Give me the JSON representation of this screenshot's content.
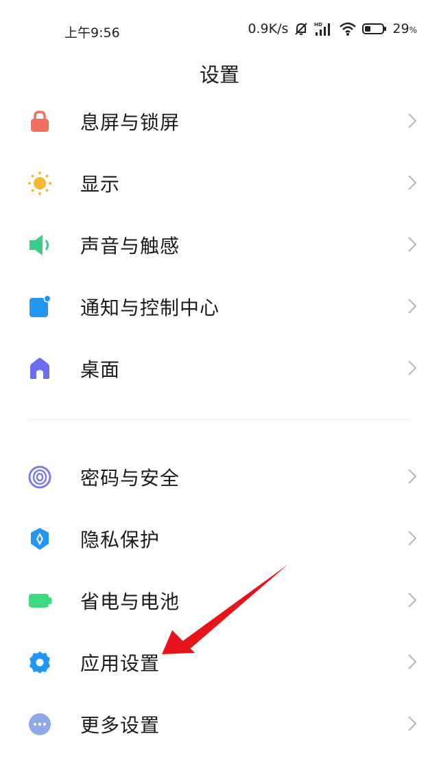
{
  "status": {
    "time": "上午9:56",
    "net_speed": "0.9K/s",
    "battery": "29",
    "battery_unit": "%"
  },
  "page": {
    "title": "设置"
  },
  "group1": [
    {
      "label": "息屏与锁屏",
      "icon": "lock-icon",
      "color": "#F2705F"
    },
    {
      "label": "显示",
      "icon": "sun-icon",
      "color": "#F7B731"
    },
    {
      "label": "声音与触感",
      "icon": "speaker-icon",
      "color": "#3DCB87"
    },
    {
      "label": "通知与控制中心",
      "icon": "notification-icon",
      "color": "#2196F3"
    },
    {
      "label": "桌面",
      "icon": "home-icon",
      "color": "#6C6CF0"
    }
  ],
  "group2": [
    {
      "label": "密码与安全",
      "icon": "fingerprint-icon",
      "color": "#7B7BE8"
    },
    {
      "label": "隐私保护",
      "icon": "privacy-shield-icon",
      "color": "#2196F3"
    },
    {
      "label": "省电与电池",
      "icon": "battery-icon",
      "color": "#3DDB7F"
    },
    {
      "label": "应用设置",
      "icon": "gear-icon",
      "color": "#2196F3"
    },
    {
      "label": "更多设置",
      "icon": "more-icon",
      "color": "#8FA8E8"
    }
  ],
  "annotation": {
    "arrow_color": "#E8141C"
  }
}
